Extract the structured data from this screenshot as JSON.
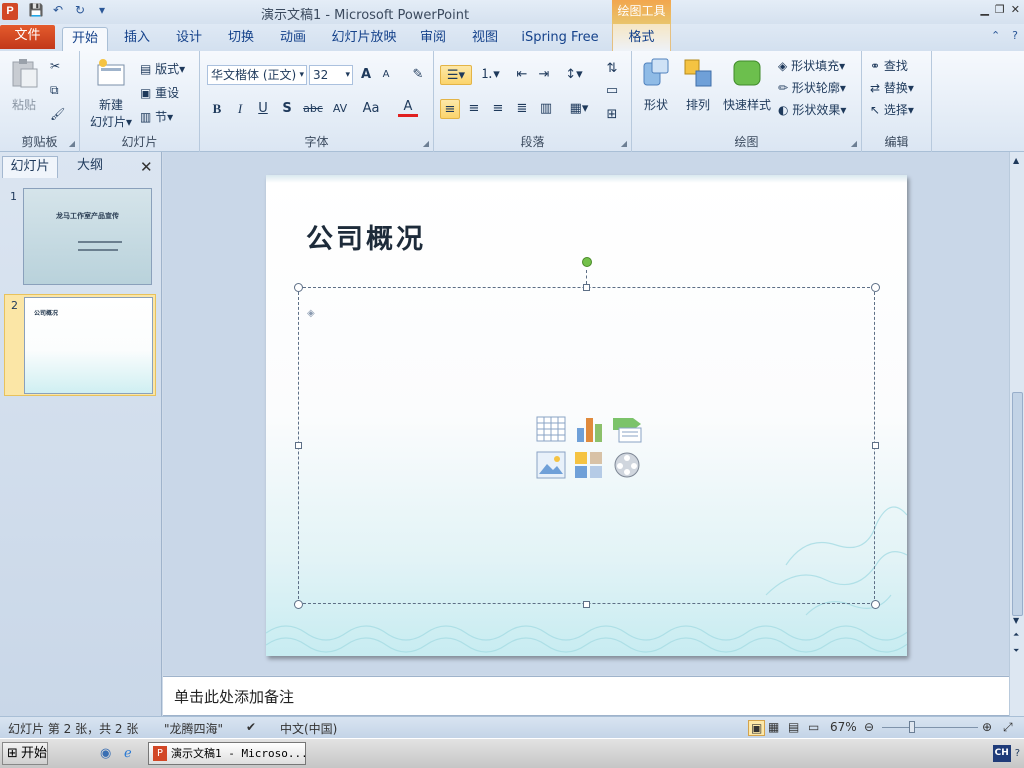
{
  "window": {
    "title": "演示文稿1 - Microsoft PowerPoint",
    "app_letter": "P",
    "contextual_tool": "绘图工具"
  },
  "qat": {
    "save": "💾",
    "undo": "↶",
    "redo": "↻",
    "customize": "▾"
  },
  "tabs": [
    {
      "label": "文件",
      "kind": "file"
    },
    {
      "label": "开始",
      "kind": "active"
    },
    {
      "label": "插入"
    },
    {
      "label": "设计"
    },
    {
      "label": "切换"
    },
    {
      "label": "动画"
    },
    {
      "label": "幻灯片放映"
    },
    {
      "label": "审阅"
    },
    {
      "label": "视图"
    },
    {
      "label": "iSpring Free"
    },
    {
      "label": "格式",
      "kind": "ctx"
    }
  ],
  "ribbon": {
    "clipboard": {
      "paste": "粘贴",
      "label": "剪贴板"
    },
    "slides": {
      "new_slide": "新建",
      "new_slide2": "幻灯片▾",
      "layout": "版式▾",
      "reset": "重设",
      "section": "节▾",
      "label": "幻灯片"
    },
    "font": {
      "name": "华文楷体 (正文)",
      "size": "32",
      "grow": "A",
      "shrink": "A",
      "bold": "B",
      "italic": "I",
      "underline": "U",
      "shadow": "S",
      "strike": "abc",
      "spacing": "AV",
      "case": "Aa",
      "color": "A",
      "label": "字体"
    },
    "paragraph": {
      "label": "段落"
    },
    "drawing": {
      "shapes": "形状",
      "arrange": "排列",
      "quick_styles": "快速样式",
      "fill": "形状填充▾",
      "outline": "形状轮廓▾",
      "effects": "形状效果▾",
      "label": "绘图"
    },
    "editing": {
      "find": "查找",
      "replace": "替换▾",
      "select": "选择▾",
      "label": "编辑"
    }
  },
  "panel": {
    "tab_slides": "幻灯片",
    "tab_outline": "大纲",
    "close": "✕",
    "thumbnails": [
      {
        "num": "1",
        "title": "龙马工作室产品宣传"
      },
      {
        "num": "2",
        "title": "公司概况"
      }
    ]
  },
  "slide": {
    "title": "公司概况"
  },
  "notes": {
    "placeholder": "单击此处添加备注"
  },
  "status": {
    "slide_info": "幻灯片 第 2 张，共 2 张",
    "theme": "\"龙腾四海\"",
    "language": "中文(中国)",
    "zoom": "67%",
    "zoom_level": 0.67
  },
  "taskbar": {
    "start": "开始",
    "app": "演示文稿1 - Microso...",
    "ime": "CH"
  },
  "colors": {
    "accent": "#d24726",
    "ribbon_text": "#15428b",
    "tool_tab": "#f2a64e"
  }
}
